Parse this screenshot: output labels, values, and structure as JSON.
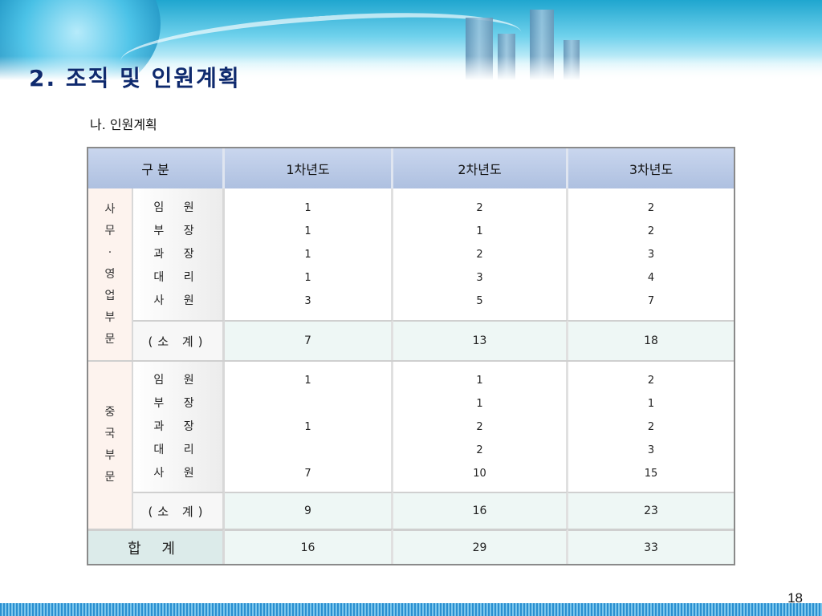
{
  "title": "2. 조직 및 인원계획",
  "subtitle": "나. 인원계획",
  "page_number": "18",
  "table": {
    "headers": [
      "구 분",
      "1차년도",
      "2차년도",
      "3차년도"
    ],
    "group1": {
      "name_chars": [
        "사",
        "무",
        "·",
        "영",
        "업",
        "부",
        "문"
      ],
      "roles": [
        "임 원",
        "부 장",
        "과 장",
        "대 리",
        "사 원"
      ],
      "year1": [
        "1",
        "1",
        "1",
        "1",
        "3"
      ],
      "year2": [
        "2",
        "1",
        "2",
        "3",
        "5"
      ],
      "year3": [
        "2",
        "2",
        "3",
        "4",
        "7"
      ],
      "subtotal_label": "(소 계)",
      "subtotal": [
        "7",
        "13",
        "18"
      ]
    },
    "group2": {
      "name_chars": [
        "중",
        "국",
        "부",
        "문"
      ],
      "roles": [
        "임 원",
        "부 장",
        "과 장",
        "대 리",
        "사 원"
      ],
      "year1": [
        "1",
        "",
        "1",
        "",
        "7"
      ],
      "year2": [
        "1",
        "1",
        "2",
        "2",
        "10"
      ],
      "year3": [
        "2",
        "1",
        "2",
        "3",
        "15"
      ],
      "subtotal_label": "(소 계)",
      "subtotal": [
        "9",
        "16",
        "23"
      ]
    },
    "total_label": "합 계",
    "total": [
      "16",
      "29",
      "33"
    ]
  },
  "colors": {
    "title": "#0f2a6e",
    "header_bg": "#aec0e0",
    "group_bg": "#fdf3ee",
    "subtotal_bg": "#eef7f5"
  }
}
